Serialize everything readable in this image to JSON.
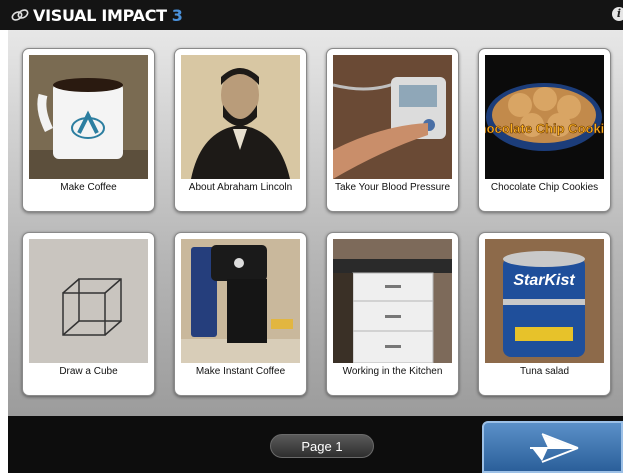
{
  "app": {
    "title": "VISUAL IMPACT",
    "version": "3"
  },
  "tiles": [
    {
      "label": "Make Coffee",
      "icon": "coffee-mug-image"
    },
    {
      "label": "About Abraham Lincoln",
      "icon": "lincoln-portrait-image"
    },
    {
      "label": "Take Your Blood Pressure",
      "icon": "blood-pressure-monitor-image"
    },
    {
      "label": "Chocolate Chip Cookies",
      "icon": "cookies-image",
      "image_text": "Chocolate Chip Cookies"
    },
    {
      "label": "Draw a Cube",
      "icon": "cube-sketch-image"
    },
    {
      "label": "Make Instant Coffee",
      "icon": "coffee-machine-image"
    },
    {
      "label": "Working in the Kitchen",
      "icon": "kitchen-image"
    },
    {
      "label": "Tuna salad",
      "icon": "tuna-can-image",
      "image_text": "StarKist"
    }
  ],
  "footer": {
    "page_label": "Page 1"
  },
  "colors": {
    "accent": "#4a90d9",
    "titlebar": "#141414",
    "next_button": "#3a73b5"
  }
}
